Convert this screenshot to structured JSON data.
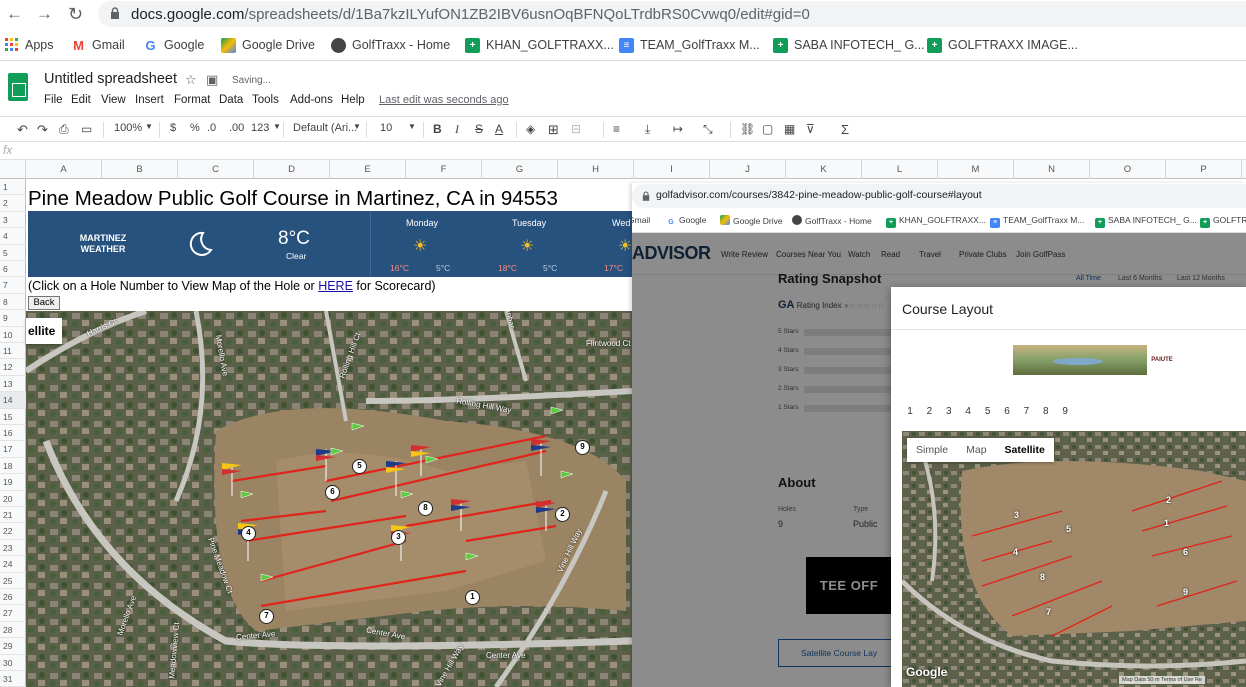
{
  "browser": {
    "url_domain": "docs.google.com",
    "url_path": "/spreadsheets/d/1Ba7kzILYufON1ZB2IBV6usnOqBFNQoLTrdbRS0Cvwq0/edit#gid=0",
    "bookmarks": [
      {
        "label": "Apps",
        "icon": "apps-grid-icon"
      },
      {
        "label": "Gmail",
        "icon": "gmail-icon"
      },
      {
        "label": "Google",
        "icon": "google-icon"
      },
      {
        "label": "Google Drive",
        "icon": "drive-icon"
      },
      {
        "label": "GolfTraxx - Home",
        "icon": "golftraxx-icon"
      },
      {
        "label": "KHAN_GOLFTRAXX...",
        "icon": "sheets-icon"
      },
      {
        "label": "TEAM_GolfTraxx M...",
        "icon": "docs-icon"
      },
      {
        "label": "SABA INFOTECH_ G...",
        "icon": "sheets-icon"
      },
      {
        "label": "GOLFTRAXX IMAGE...",
        "icon": "sheets-icon"
      }
    ]
  },
  "sheets": {
    "title": "Untitled spreadsheet",
    "saving": "Saving...",
    "menu": [
      "File",
      "Edit",
      "View",
      "Insert",
      "Format",
      "Data",
      "Tools",
      "Add-ons",
      "Help"
    ],
    "last_edit": "Last edit was seconds ago",
    "toolbar": {
      "zoom": "100%",
      "currency": "$",
      "percent": "%",
      "dec_less": ".0",
      "dec_more": ".00",
      "format": "123",
      "font": "Default (Ari...",
      "size": "10",
      "bold": "B",
      "italic": "I",
      "strike": "S",
      "underline": "A",
      "sigma": "Σ"
    },
    "fx": "fx",
    "columns": [
      "A",
      "B",
      "C",
      "D",
      "E",
      "F",
      "G",
      "H",
      "I",
      "J",
      "K",
      "L",
      "M",
      "N",
      "O",
      "P"
    ],
    "rows": [
      "1",
      "2",
      "3",
      "4",
      "5",
      "6",
      "7",
      "8",
      "9",
      "10",
      "11",
      "12",
      "13",
      "14",
      "15",
      "16",
      "17",
      "18",
      "19",
      "20",
      "21",
      "22",
      "23",
      "24",
      "25",
      "26",
      "27",
      "28",
      "29",
      "30",
      "31"
    ]
  },
  "content": {
    "course_title": "Pine Meadow Public Golf Course in Martinez, CA in 94553",
    "weather": {
      "city_line1": "MARTINEZ",
      "city_line2": "WEATHER",
      "temp": "8°C",
      "condition": "Clear",
      "days": [
        {
          "name": "Monday",
          "hi": "16°C",
          "lo": "5°C"
        },
        {
          "name": "Tuesday",
          "hi": "18°C",
          "lo": "5°C"
        },
        {
          "name": "Wed",
          "hi": "17°C",
          "lo": ""
        }
      ]
    },
    "click_prefix": "(Click on a Hole Number to View Map of the Hole or ",
    "click_link": "HERE",
    "click_suffix": " for Scorecard)",
    "back_button": "Back",
    "satellite_tab": "ellite",
    "streets": [
      "Harris Ct",
      "Morello Ave",
      "Rolling Hill Ct",
      "Rolling Hill Way",
      "Flintwood Ct",
      "Dunbar",
      "Pine Meadow Ct",
      "Center Ave",
      "Center Ave",
      "Center Ave",
      "Vine Hill Way",
      "Meadowview Ct",
      "Morello Ave",
      "Vine Hill Way"
    ],
    "hole_numbers": [
      "5",
      "6",
      "4",
      "7",
      "3",
      "8",
      "1",
      "2",
      "9"
    ]
  },
  "popup": {
    "url": "golfadvisor.com/courses/3842-pine-meadow-public-golf-course#layout",
    "bookmarks": [
      "Gmail",
      "Google",
      "Google Drive",
      "GolfTraxx - Home",
      "KHAN_GOLFTRAXX...",
      "TEAM_GolfTraxx M...",
      "SABA INFOTECH_ G...",
      "GOLFTRAXX IMA..."
    ],
    "logo": "ADVISOR",
    "nav": [
      "Write Review",
      "Courses Near You",
      "Watch",
      "Read",
      "Travel",
      "Private Clubs",
      "Join GolfPass"
    ],
    "rating_snapshot": "Rating Snapshot",
    "rating_tabs": [
      "All Time",
      "Last 6 Months",
      "Last 12 Months"
    ],
    "rating_index": "Rating Index",
    "star_labels": [
      "5 Stars",
      "4 Stars",
      "3 Stars",
      "2 Stars",
      "1 Stars"
    ],
    "about": "About",
    "holes_label": "Holes",
    "holes_value": "9",
    "type_label": "Type",
    "type_value": "Public",
    "teeoff": "TEE OFF",
    "sat_button": "Satellite Course Lay",
    "modal": {
      "title": "Course Layout",
      "banner_brand": "PAIUTE",
      "holes": [
        "1",
        "2",
        "3",
        "4",
        "5",
        "6",
        "7",
        "8",
        "9"
      ],
      "map_tabs": [
        "Simple",
        "Map",
        "Satellite"
      ],
      "active_tab": "Satellite",
      "map_holes": [
        "3",
        "5",
        "2",
        "1",
        "4",
        "6",
        "8",
        "7",
        "9"
      ],
      "google": "Google",
      "footer": "Map Data  50 m  Terms of Use  Re"
    }
  }
}
